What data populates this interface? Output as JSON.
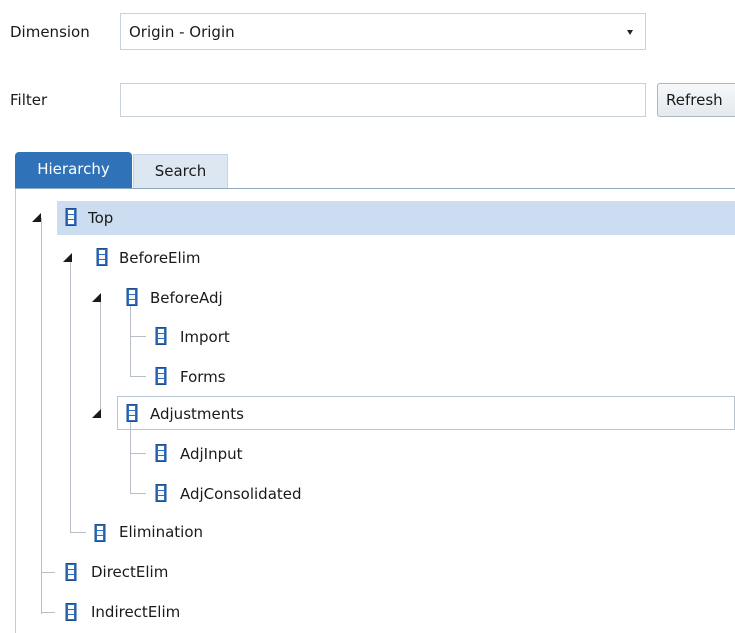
{
  "dimension": {
    "label": "Dimension",
    "value": "Origin - Origin"
  },
  "filter": {
    "label": "Filter",
    "value": "",
    "placeholder": ""
  },
  "refresh_label": "Refresh",
  "tabs": [
    {
      "label": "Hierarchy",
      "active": true
    },
    {
      "label": "Search",
      "active": false
    }
  ],
  "tree": {
    "top": "Top",
    "beforeelim": "BeforeElim",
    "beforeadj": "BeforeAdj",
    "import": "Import",
    "forms": "Forms",
    "adjustments": "Adjustments",
    "adjinput": "AdjInput",
    "adjconsolidated": "AdjConsolidated",
    "elimination": "Elimination",
    "directelim": "DirectElim",
    "indirectelim": "IndirectElim",
    "selected": "Top",
    "focused": "Adjustments"
  },
  "colors": {
    "tab_active": "#2f72b8",
    "selection": "#ccdcf1",
    "icon_blue": "#2f6fbf"
  }
}
